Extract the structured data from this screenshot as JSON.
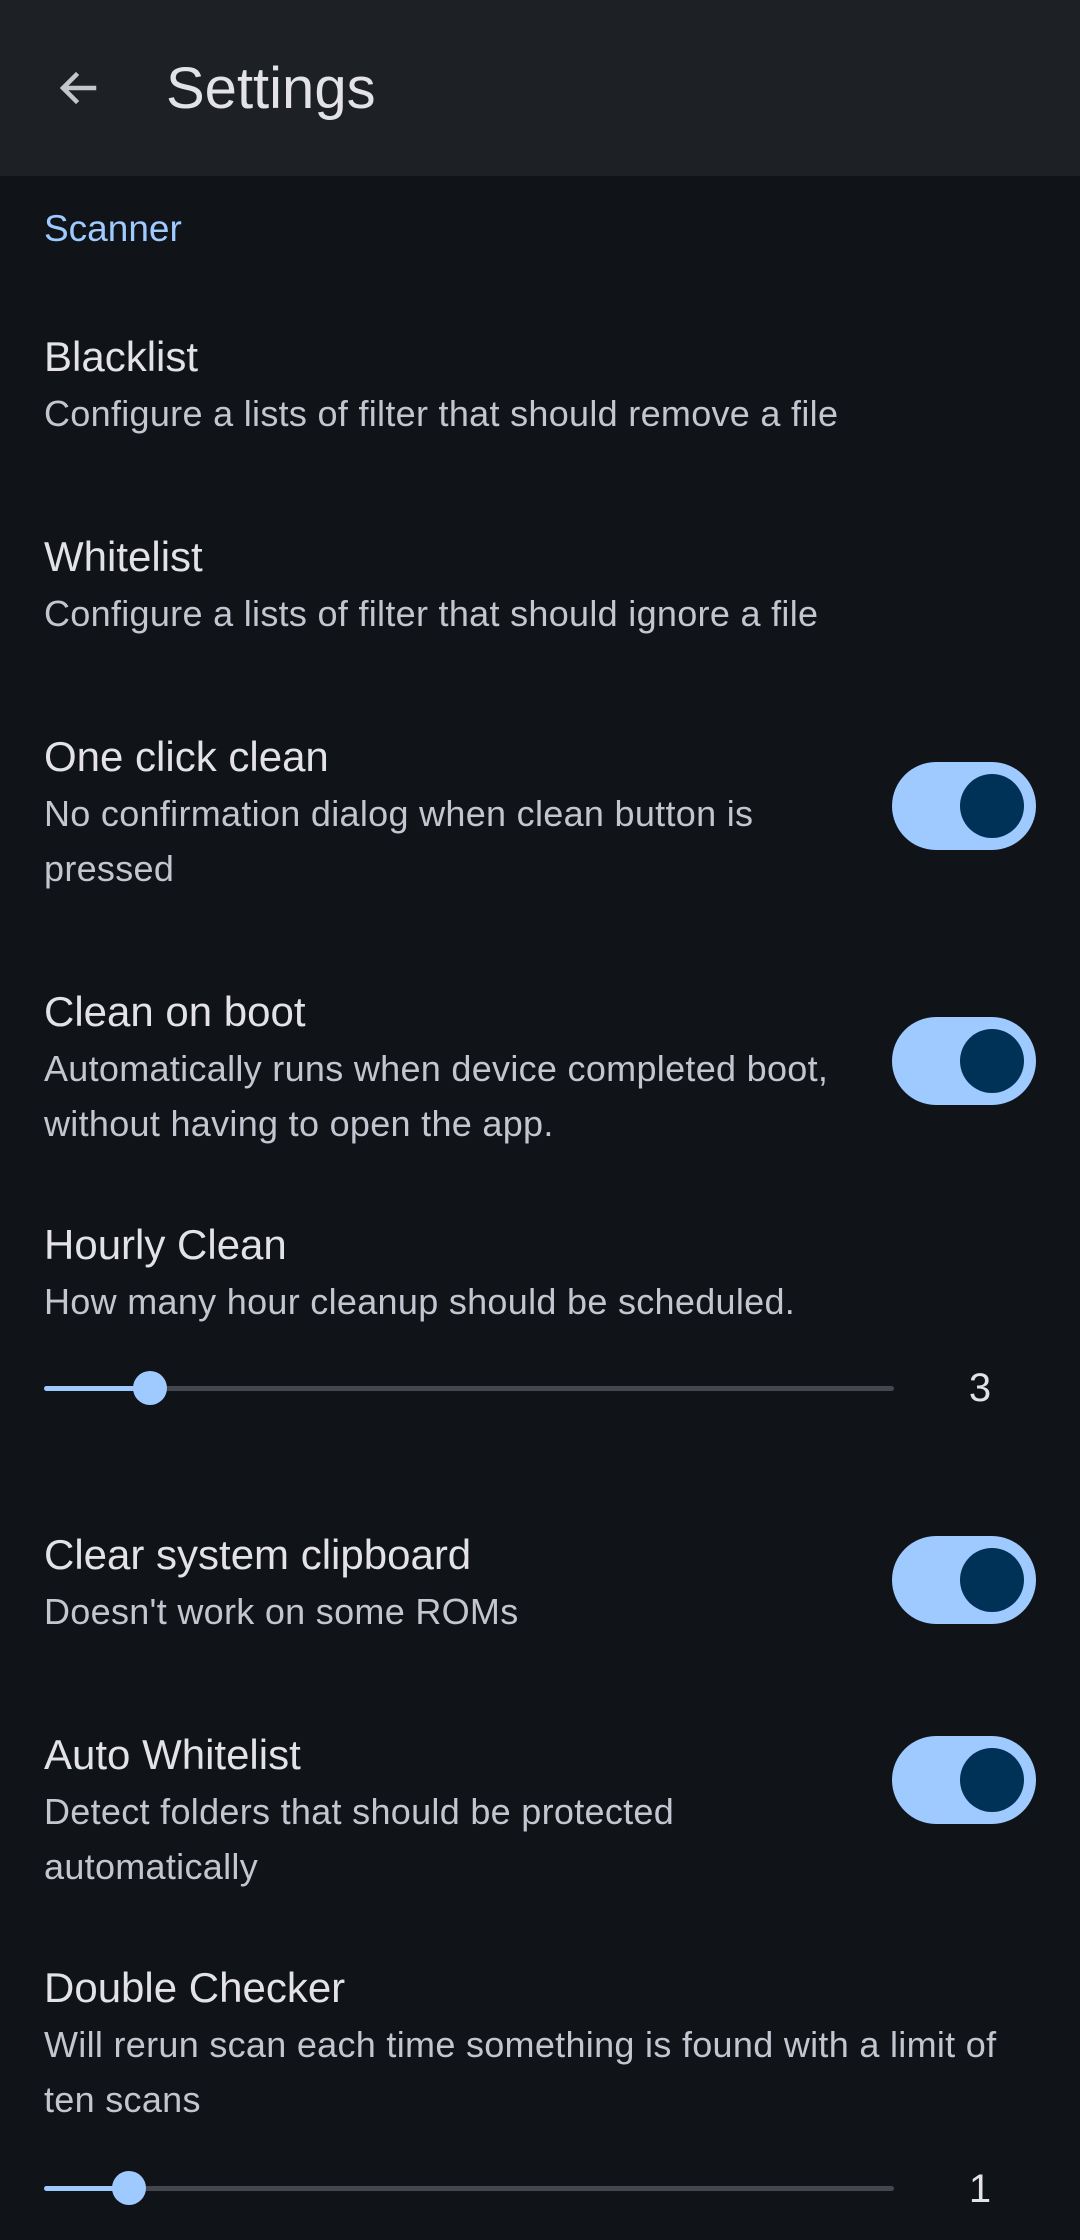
{
  "app_bar": {
    "title": "Settings",
    "back_icon": "arrow-left-icon"
  },
  "colors": {
    "accent": "#9ecaff",
    "background": "#101318",
    "app_bar": "#1d2025",
    "switch_thumb": "#003258"
  },
  "section": {
    "title": "Scanner"
  },
  "prefs": {
    "blacklist": {
      "title": "Blacklist",
      "summary": "Configure a lists of filter that should remove a file"
    },
    "whitelist": {
      "title": "Whitelist",
      "summary": "Configure a lists of filter that should ignore a file"
    },
    "one_click_clean": {
      "title": "One click clean",
      "summary": "No confirmation dialog when clean button is pressed",
      "enabled": true
    },
    "clean_on_boot": {
      "title": "Clean on boot",
      "summary": "Automatically runs when device completed boot, without having to open the app.",
      "enabled": true
    },
    "hourly_clean": {
      "title": "Hourly Clean",
      "summary": "How many hour cleanup should be scheduled.",
      "value": "3",
      "level": 0.125
    },
    "clear_clipboard": {
      "title": "Clear system clipboard",
      "summary": "Doesn't work on some ROMs",
      "enabled": true
    },
    "auto_whitelist": {
      "title": "Auto Whitelist",
      "summary": "Detect folders that should be protected automatically",
      "enabled": true
    },
    "double_checker": {
      "title": "Double Checker",
      "summary": "Will rerun scan each time something is found with a limit of ten scans",
      "value": "1",
      "level": 0.1
    }
  }
}
